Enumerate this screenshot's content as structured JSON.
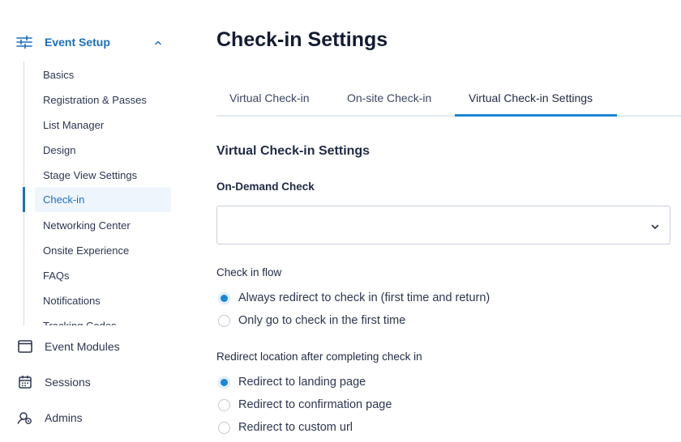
{
  "sidebar": {
    "section": {
      "label": "Event Setup",
      "icon": "sliders-icon",
      "expanded": true
    },
    "sub_items": [
      {
        "label": "Basics"
      },
      {
        "label": "Registration & Passes"
      },
      {
        "label": "List Manager"
      },
      {
        "label": "Design"
      },
      {
        "label": "Stage View Settings"
      },
      {
        "label": "Check-in",
        "active": true
      },
      {
        "label": "Networking Center"
      },
      {
        "label": "Onsite Experience"
      },
      {
        "label": "FAQs"
      },
      {
        "label": "Notifications"
      },
      {
        "label": "Tracking Codes"
      }
    ],
    "main_items": [
      {
        "label": "Event Modules",
        "icon": "window-icon"
      },
      {
        "label": "Sessions",
        "icon": "calendar-icon"
      },
      {
        "label": "Admins",
        "icon": "admin-user-icon"
      }
    ]
  },
  "page": {
    "title": "Check-in Settings",
    "tabs": [
      {
        "label": "Virtual Check-in"
      },
      {
        "label": "On-site Check-in"
      },
      {
        "label": "Virtual Check-in Settings",
        "active": true
      }
    ],
    "section_title": "Virtual Check-in Settings",
    "on_demand": {
      "label": "On-Demand Check",
      "value": ""
    },
    "check_in_flow": {
      "label": "Check in flow",
      "options": [
        {
          "label": "Always redirect to check in (first time and return)",
          "checked": true
        },
        {
          "label": "Only go to check in the first time",
          "checked": false
        }
      ]
    },
    "redirect_location": {
      "label": "Redirect location after completing check in",
      "options": [
        {
          "label": "Redirect to landing page",
          "checked": true
        },
        {
          "label": "Redirect to confirmation page",
          "checked": false
        },
        {
          "label": "Redirect to custom url",
          "checked": false
        }
      ]
    }
  },
  "colors": {
    "accent": "#1a86d8",
    "nav_active": "#1a6fc0",
    "active_bg": "#eef5fd"
  }
}
